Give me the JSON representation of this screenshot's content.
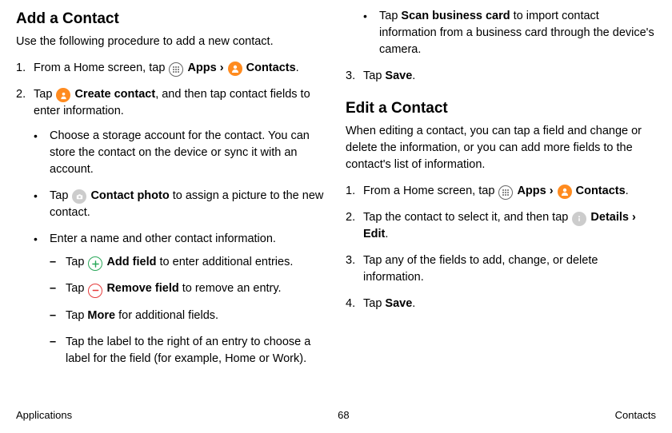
{
  "footer": {
    "left": "Applications",
    "page": "68",
    "right": "Contacts"
  },
  "left": {
    "heading": "Add a Contact",
    "intro": "Use the following procedure to add a new contact.",
    "step1": {
      "prefix": "From a Home screen, tap ",
      "apps": "Apps",
      "sep": " › ",
      "contacts": "Contacts",
      "end": "."
    },
    "step2": {
      "prefix": "Tap ",
      "create": "Create contact",
      "suffix": ", and then tap contact fields to enter information."
    },
    "b1": "Choose a storage account for the contact. You can store the contact on the device or sync it with an account.",
    "b2": {
      "prefix": "Tap ",
      "photo": "Contact photo",
      "suffix": " to assign a picture to the new contact."
    },
    "b3": "Enter a name and other contact information.",
    "d1": {
      "prefix": "Tap ",
      "add": "Add field",
      "suffix": " to enter additional entries."
    },
    "d2": {
      "prefix": "Tap ",
      "remove": "Remove field",
      "suffix": " to remove an entry."
    },
    "d3": {
      "prefix": "Tap ",
      "more": "More",
      "suffix": " for additional fields."
    },
    "d4": "Tap the label to the right of an entry to choose a label for the field (for example, Home or Work)."
  },
  "right": {
    "b1": {
      "prefix": "Tap ",
      "scan": "Scan business card",
      "suffix": " to import contact information from a business card through the device's camera."
    },
    "step3": {
      "prefix": "Tap ",
      "save": "Save",
      "end": "."
    },
    "heading": "Edit a Contact",
    "intro": "When editing a contact, you can tap a field and change or delete the information, or you can add more fields to the contact's list of information.",
    "e1": {
      "prefix": "From a Home screen, tap ",
      "apps": "Apps",
      "sep": " › ",
      "contacts": "Contacts",
      "end": "."
    },
    "e2": {
      "prefix": "Tap the contact to select it, and then tap ",
      "details": "Details",
      "sep": " › ",
      "edit": "Edit",
      "end": "."
    },
    "e3": "Tap any of the fields to add, change, or delete information.",
    "e4": {
      "prefix": "Tap ",
      "save": "Save",
      "end": "."
    }
  }
}
